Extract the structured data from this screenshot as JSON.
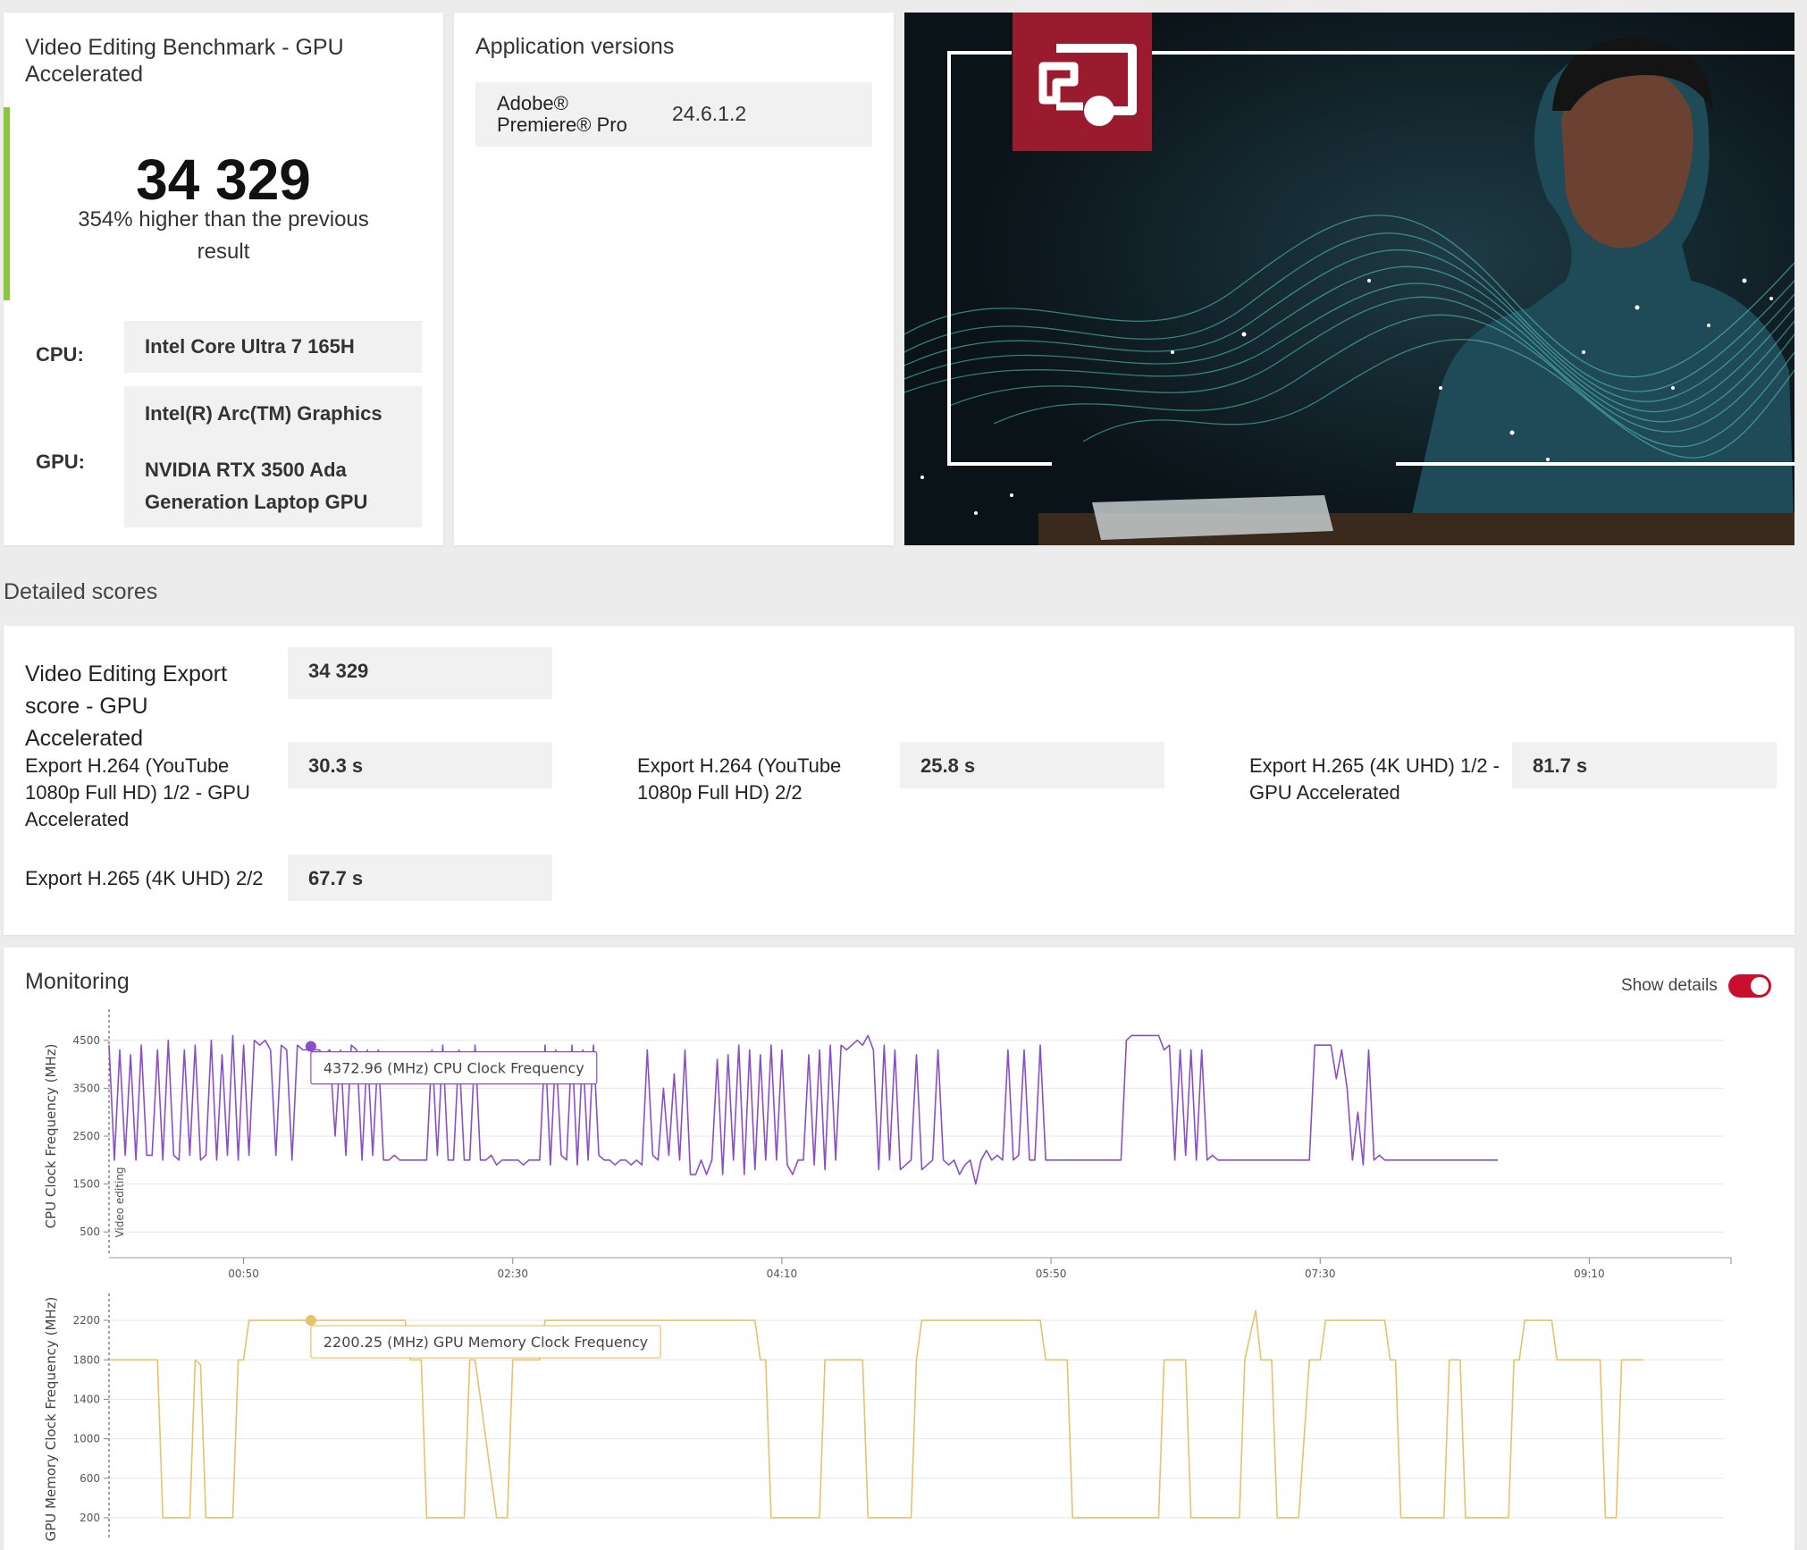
{
  "score_card": {
    "title": "Video Editing Benchmark - GPU Accelerated",
    "score": "34 329",
    "comparison": "354% higher than the previous result",
    "cpu_label": "CPU:",
    "cpu_value": "Intel Core Ultra 7 165H",
    "gpu_label": "GPU:",
    "gpu_values": [
      "Intel(R) Arc(TM) Graphics",
      "NVIDIA RTX 3500 Ada Generation Laptop GPU"
    ],
    "accent_color": "#8cc63f"
  },
  "app_versions": {
    "title": "Application versions",
    "items": [
      {
        "name": "Adobe® Premiere® Pro",
        "version": "24.6.1.2"
      }
    ]
  },
  "hero": {
    "icon": "presentation-icon",
    "badge_color": "#9b1b2e"
  },
  "detailed_scores": {
    "title": "Detailed scores",
    "main": {
      "label": "Video Editing Export score - GPU Accelerated",
      "value": "34 329"
    },
    "items": [
      {
        "label": "Export H.264 (YouTube 1080p Full HD) 1/2 - GPU Accelerated",
        "value": "30.3 s"
      },
      {
        "label": "Export H.264 (YouTube 1080p Full HD) 2/2",
        "value": "25.8 s"
      },
      {
        "label": "Export H.265 (4K UHD) 1/2 - GPU Accelerated",
        "value": "81.7 s"
      },
      {
        "label": "Export H.265 (4K UHD) 2/2",
        "value": "67.7 s"
      }
    ]
  },
  "monitoring": {
    "title": "Monitoring",
    "show_details_label": "Show details",
    "show_details_on": true,
    "toggle_color": "#c8102e"
  },
  "chart_data": [
    {
      "type": "line",
      "ylabel": "CPU Clock Frequency (MHz)",
      "band_label": "Video editing",
      "y_ticks": [
        500,
        1500,
        2500,
        3500,
        4500
      ],
      "ylim": [
        0,
        5000
      ],
      "x_tick_labels": [
        "00:50",
        "02:30",
        "04:10",
        "05:50",
        "07:30",
        "09:10"
      ],
      "x_tick_values": [
        50,
        150,
        250,
        350,
        450,
        550
      ],
      "xlim": [
        0,
        600
      ],
      "color": "#8a4fc6",
      "tooltip": {
        "x": 75,
        "y": 4372.96,
        "text": "4372.96 (MHz) CPU Clock Frequency"
      },
      "grid": true,
      "x": [
        0,
        2,
        4,
        6,
        8,
        10,
        12,
        14,
        16,
        18,
        20,
        22,
        24,
        26,
        28,
        30,
        32,
        34,
        36,
        38,
        40,
        42,
        44,
        46,
        48,
        50,
        52,
        54,
        56,
        58,
        60,
        62,
        64,
        66,
        68,
        70,
        72,
        74,
        76,
        78,
        80,
        82,
        84,
        86,
        88,
        90,
        92,
        94,
        96,
        98,
        100,
        102,
        104,
        106,
        108,
        110,
        112,
        114,
        116,
        118,
        120,
        122,
        124,
        126,
        128,
        130,
        132,
        134,
        136,
        138,
        140,
        142,
        144,
        146,
        148,
        150,
        152,
        154,
        156,
        158,
        160,
        162,
        164,
        166,
        168,
        170,
        172,
        174,
        176,
        178,
        180,
        182,
        184,
        186,
        188,
        190,
        192,
        194,
        196,
        198,
        200,
        202,
        204,
        206,
        208,
        210,
        212,
        214,
        216,
        218,
        220,
        222,
        224,
        226,
        228,
        230,
        232,
        234,
        236,
        238,
        240,
        242,
        244,
        246,
        248,
        250,
        252,
        254,
        256,
        258,
        260,
        262,
        264,
        266,
        268,
        270,
        272,
        274,
        276,
        278,
        280,
        282,
        284,
        286,
        288,
        290,
        292,
        294,
        296,
        298,
        300,
        302,
        304,
        306,
        308,
        310,
        312,
        314,
        316,
        318,
        320,
        322,
        324,
        326,
        328,
        330,
        332,
        334,
        336,
        338,
        340,
        342,
        344,
        346,
        348,
        350,
        352,
        354,
        356,
        358,
        360,
        362,
        364,
        366,
        368,
        370,
        372,
        374,
        376,
        378,
        380,
        382,
        384,
        386,
        388,
        390,
        392,
        394,
        396,
        398,
        400,
        402,
        404,
        406,
        408,
        410,
        412,
        414,
        416,
        418,
        420,
        422,
        424,
        426,
        428,
        430,
        432,
        434,
        436,
        438,
        440,
        442,
        444,
        446,
        448,
        450,
        452,
        454,
        456,
        458,
        460,
        462,
        464,
        466,
        468,
        470,
        472,
        474,
        476,
        478,
        480,
        482,
        484,
        486,
        488,
        490,
        492,
        494,
        496,
        498,
        500,
        502,
        504,
        506,
        508,
        510,
        512,
        514,
        516,
        518,
        520,
        522,
        524,
        526,
        528,
        530,
        532,
        534,
        536,
        538,
        540,
        542,
        544,
        546,
        548,
        550,
        552,
        554,
        556,
        558,
        560,
        562,
        564,
        566,
        568,
        570
      ],
      "y": [
        4400,
        2000,
        4300,
        2100,
        4200,
        2000,
        4400,
        2100,
        2100,
        4300,
        2000,
        4500,
        2100,
        2000,
        4300,
        2100,
        4400,
        2000,
        2100,
        4500,
        2000,
        4200,
        2100,
        4600,
        2000,
        4400,
        2100,
        4500,
        4400,
        4500,
        4300,
        2100,
        4400,
        4300,
        2000,
        4400,
        4300,
        4300,
        4300,
        4300,
        4200,
        4300,
        2500,
        4300,
        2100,
        4400,
        4300,
        2000,
        4300,
        2100,
        4300,
        2000,
        2000,
        2100,
        2000,
        2000,
        2000,
        2000,
        2000,
        2000,
        4300,
        2100,
        4400,
        2000,
        2000,
        4300,
        2000,
        2000,
        4400,
        2000,
        2000,
        2100,
        1900,
        2000,
        2000,
        2000,
        2000,
        1900,
        2000,
        2000,
        2000,
        4400,
        1900,
        4300,
        2100,
        2000,
        4400,
        1900,
        4300,
        2000,
        4400,
        2100,
        2000,
        2000,
        1900,
        2000,
        2000,
        1900,
        2000,
        1900,
        4300,
        2100,
        2000,
        3500,
        2100,
        3800,
        2000,
        4300,
        1700,
        1700,
        2000,
        1700,
        2000,
        4100,
        1700,
        4200,
        2000,
        4400,
        1700,
        4300,
        1800,
        4200,
        2000,
        4400,
        2000,
        4300,
        1900,
        1700,
        2000,
        2000,
        4200,
        1900,
        4300,
        1800,
        4400,
        2000,
        4400,
        4300,
        4400,
        4500,
        4400,
        4600,
        4300,
        1800,
        4400,
        2000,
        4300,
        1800,
        1900,
        2000,
        4200,
        1800,
        1900,
        2000,
        4300,
        2000,
        1900,
        2000,
        1700,
        1900,
        2000,
        1500,
        2000,
        2200,
        2000,
        2100,
        2000,
        4300,
        2000,
        2100,
        4300,
        2000,
        2000,
        4400,
        2000,
        2000,
        2000,
        2000,
        2000,
        2000,
        2000,
        2000,
        2000,
        2000,
        2000,
        2000,
        2000,
        2000,
        2000,
        4500,
        4600,
        4600,
        4600,
        4600,
        4600,
        4600,
        4300,
        4400,
        2000,
        4300,
        2100,
        4300,
        2000,
        4300,
        2000,
        2100,
        2000,
        2000,
        2000,
        2000,
        2000,
        2000,
        2000,
        2000,
        2000,
        2000,
        2000,
        2000,
        2000,
        2000,
        2000,
        2000,
        2000,
        2000,
        4400,
        4400,
        4400,
        4400,
        3700,
        4300,
        3500,
        2000,
        3000,
        1900,
        4300,
        2000,
        2100,
        2000,
        2000,
        2000,
        2000,
        2000,
        2000,
        2000,
        2000,
        2000,
        2000,
        2000,
        2000,
        2000,
        2000,
        2000,
        2000,
        2000,
        2000,
        2000,
        2000,
        2000,
        2000
      ]
    },
    {
      "type": "line",
      "ylabel": "GPU Memory Clock Frequency (MHz)",
      "y_ticks": [
        200,
        600,
        1000,
        1400,
        1800,
        2200
      ],
      "ylim": [
        0,
        2400
      ],
      "xlim": [
        0,
        600
      ],
      "color": "#e8c16a",
      "tooltip": {
        "x": 75,
        "y": 2200.25,
        "text": "2200.25 (MHz) GPU Memory Clock Frequency"
      },
      "grid": true,
      "x": [
        0,
        18,
        20,
        22,
        30,
        32,
        34,
        36,
        38,
        46,
        48,
        50,
        52,
        110,
        112,
        116,
        118,
        120,
        132,
        134,
        136,
        144,
        146,
        148,
        150,
        160,
        162,
        168,
        170,
        240,
        242,
        244,
        246,
        252,
        254,
        264,
        266,
        270,
        272,
        280,
        282,
        292,
        294,
        298,
        300,
        302,
        304,
        306,
        308,
        312,
        314,
        324,
        326,
        346,
        348,
        356,
        358,
        374,
        376,
        390,
        392,
        400,
        402,
        404,
        406,
        408,
        410,
        420,
        422,
        426,
        428,
        432,
        434,
        436,
        438,
        442,
        446,
        448,
        450,
        452,
        454,
        456,
        472,
        474,
        476,
        478,
        480,
        494,
        496,
        498,
        500,
        502,
        504,
        510,
        512,
        520,
        522,
        524,
        526,
        528,
        530,
        532,
        534,
        536,
        538,
        554,
        556,
        560,
        562,
        564,
        566,
        570
      ],
      "y": [
        1800,
        1800,
        200,
        200,
        200,
        1800,
        1750,
        200,
        200,
        200,
        1800,
        1800,
        2200,
        2200,
        1800,
        1800,
        200,
        200,
        200,
        1800,
        1800,
        200,
        200,
        200,
        1800,
        1800,
        2200,
        2200,
        2200,
        2200,
        1800,
        1800,
        200,
        200,
        200,
        200,
        1800,
        1800,
        1800,
        1800,
        200,
        200,
        200,
        200,
        1800,
        2200,
        2200,
        2200,
        2200,
        2200,
        2200,
        2200,
        2200,
        2200,
        1800,
        1800,
        200,
        200,
        200,
        200,
        1800,
        1800,
        200,
        200,
        200,
        200,
        200,
        200,
        1800,
        2300,
        1800,
        1800,
        200,
        200,
        200,
        200,
        1800,
        1800,
        1800,
        2200,
        2200,
        2200,
        2200,
        2200,
        1800,
        1800,
        200,
        200,
        200,
        1800,
        1800,
        1800,
        200,
        200,
        200,
        200,
        1800,
        1800,
        2200,
        2200,
        2200,
        2200,
        2200,
        2200,
        1800,
        1800,
        200,
        200,
        1800,
        1800,
        1800,
        1800
      ]
    }
  ]
}
